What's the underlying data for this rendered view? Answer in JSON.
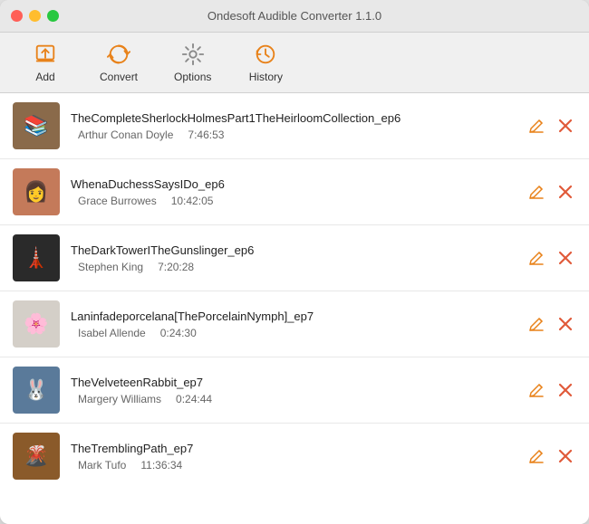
{
  "window": {
    "title": "Ondesoft Audible Converter 1.1.0"
  },
  "toolbar": {
    "add_label": "Add",
    "convert_label": "Convert",
    "options_label": "Options",
    "history_label": "History"
  },
  "books": [
    {
      "id": 1,
      "title": "TheCompleteSherlockHolmesPart1TheHeirloomCollection_ep6",
      "author": "Arthur Conan Doyle",
      "duration": "7:46:53",
      "cover_emoji": "📚",
      "cover_class": "cover-1"
    },
    {
      "id": 2,
      "title": "WhenaDuchessSaysIDo_ep6",
      "author": "Grace Burrowes",
      "duration": "10:42:05",
      "cover_emoji": "👩",
      "cover_class": "cover-2"
    },
    {
      "id": 3,
      "title": "TheDarkTowerITheGunslinger_ep6",
      "author": "Stephen King",
      "duration": "7:20:28",
      "cover_emoji": "🗼",
      "cover_class": "cover-3"
    },
    {
      "id": 4,
      "title": "Laninfadeporcelana[ThePorcelainNymph]_ep7",
      "author": "Isabel Allende",
      "duration": "0:24:30",
      "cover_emoji": "🌸",
      "cover_class": "cover-4"
    },
    {
      "id": 5,
      "title": "TheVelveteenRabbit_ep7",
      "author": "Margery Williams",
      "duration": "0:24:44",
      "cover_emoji": "🐰",
      "cover_class": "cover-5"
    },
    {
      "id": 6,
      "title": "TheTremblingPath_ep7",
      "author": "Mark Tufo",
      "duration": "11:36:34",
      "cover_emoji": "🌋",
      "cover_class": "cover-6"
    }
  ]
}
